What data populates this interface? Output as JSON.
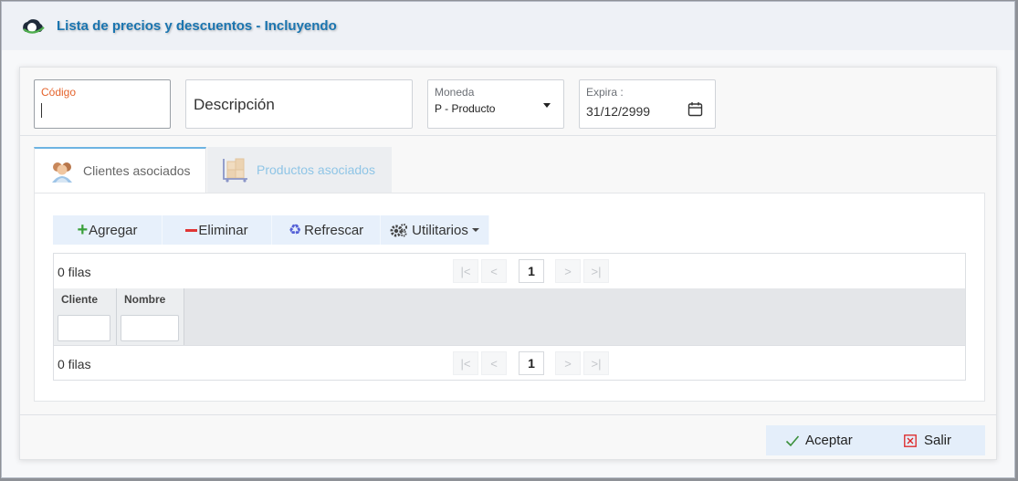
{
  "window": {
    "title": "Lista de precios y descuentos - Incluyendo"
  },
  "fields": {
    "codigo": {
      "label": "Código",
      "value": ""
    },
    "descripcion": {
      "placeholder": "Descripción",
      "value": ""
    },
    "moneda": {
      "label": "Moneda",
      "value": "P - Producto"
    },
    "expira": {
      "label": "Expira :",
      "value": "31/12/2999"
    }
  },
  "tabs": [
    {
      "label": "Clientes asociados",
      "icon": "people-icon",
      "active": true
    },
    {
      "label": "Productos asociados",
      "icon": "boxes-cart-icon",
      "active": false
    }
  ],
  "toolbar": {
    "add_label": "Agregar",
    "delete_label": "Eliminar",
    "refresh_label": "Refrescar",
    "utilities_label": "Utilitarios"
  },
  "grid": {
    "rows_label_top": "0 filas",
    "rows_label_bottom": "0 filas",
    "current_page": "1",
    "columns": [
      "Cliente",
      "Nombre"
    ]
  },
  "footer": {
    "accept_label": "Aceptar",
    "exit_label": "Salir"
  },
  "colors": {
    "title": "#1a75b0",
    "codigo_label": "#e4632c",
    "add": "#3aa03a",
    "delete": "#e03535",
    "refresh": "#5460d6",
    "button_bg": "#e7f0fb"
  }
}
